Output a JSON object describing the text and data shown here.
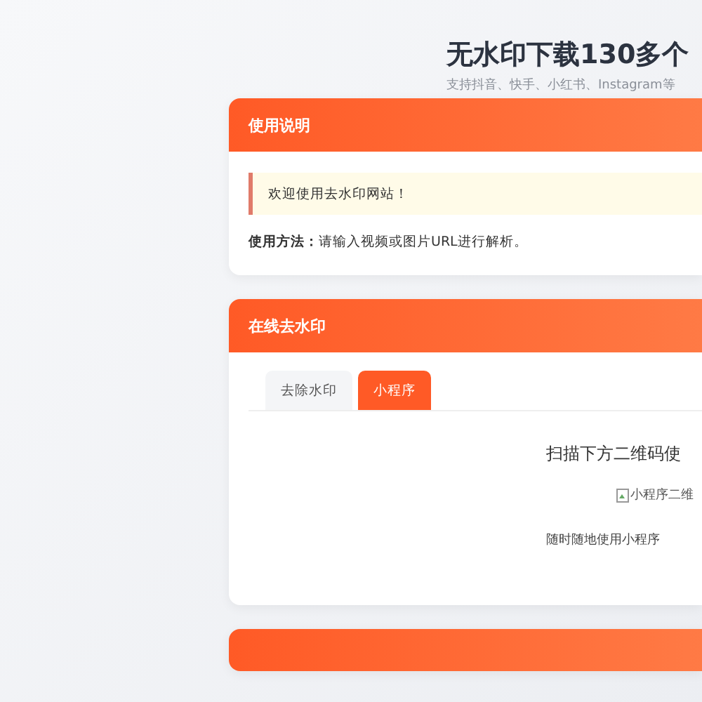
{
  "page": {
    "title": "无水印下载130多个",
    "subtitle": "支持抖音、快手、小红书、Instagram等"
  },
  "guide_card": {
    "title": "使用说明",
    "notice": "欢迎使用去水印网站！",
    "usage_label": "使用方法：",
    "usage_text": "请输入视频或图片URL进行解析。"
  },
  "tool_card": {
    "title": "在线去水印",
    "tabs": [
      {
        "label": "去除水印",
        "selected": false
      },
      {
        "label": "小程序",
        "selected": true
      }
    ],
    "scan_text": "扫描下方二维码使",
    "image_alt": "小程序二维",
    "caption": "随时随地使用小程序"
  },
  "next_card": {
    "kind": "header"
  }
}
